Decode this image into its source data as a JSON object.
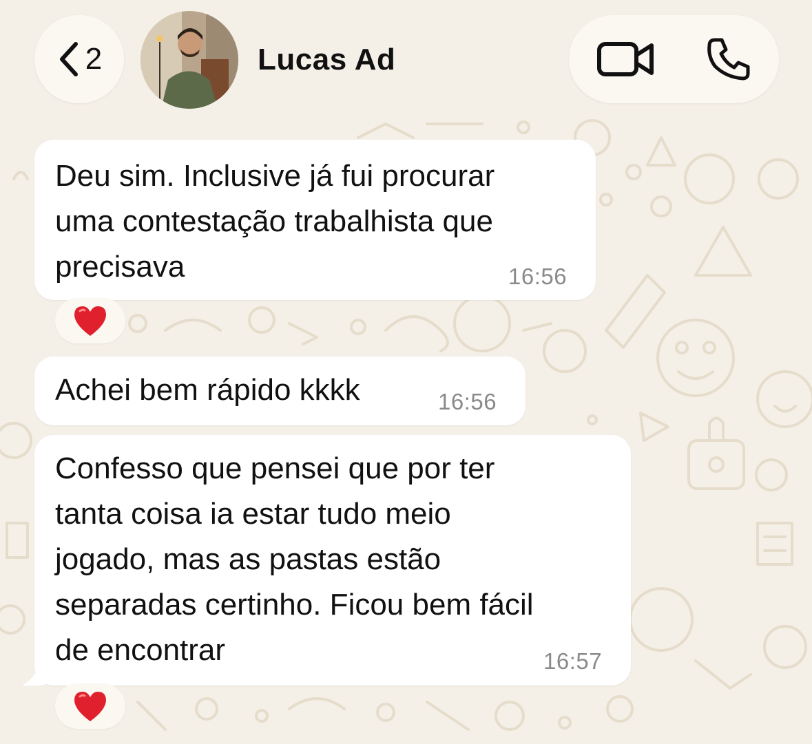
{
  "colors": {
    "background": "#f4efe7",
    "bubble": "#ffffff",
    "pill": "#fbf8f2",
    "heart": "#e0212d",
    "timestamp": "#8a8a8a"
  },
  "header": {
    "back_count": "2",
    "contact_name": "Lucas Ad",
    "icons": [
      "chevron-left-icon",
      "video-camera-icon",
      "phone-icon"
    ]
  },
  "messages": [
    {
      "text": "Deu sim. Inclusive já fui procurar\numa contestação trabalhista que\nprecisava",
      "time": "16:56",
      "reaction": "❤️"
    },
    {
      "text": "Achei bem rápido kkkk",
      "time": "16:56"
    },
    {
      "text": "Confesso que pensei que por ter\ntanta coisa ia estar tudo meio\njogado, mas as pastas estão\nseparadas certinho. Ficou bem fácil\nde encontrar",
      "time": "16:57",
      "reaction": "❤️"
    }
  ]
}
